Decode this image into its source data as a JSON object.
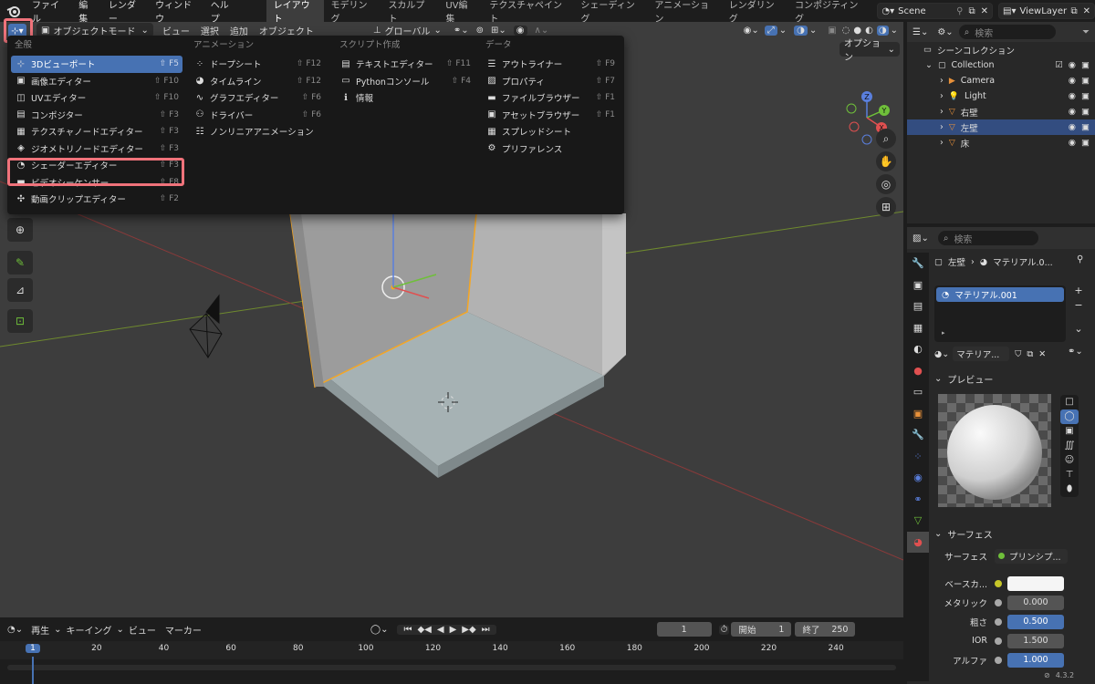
{
  "topbar": {
    "menus": [
      "ファイル",
      "編集",
      "レンダー",
      "ウィンドウ",
      "ヘルプ"
    ],
    "workspaces": [
      "レイアウト",
      "モデリング",
      "スカルプト",
      "UV編集",
      "テクスチャペイント",
      "シェーディング",
      "アニメーション",
      "レンダリング",
      "コンポジティング"
    ],
    "active_workspace": "レイアウト",
    "scene": "Scene",
    "view_layer": "ViewLayer"
  },
  "viewport_header": {
    "mode": "オブジェクトモード",
    "menus": [
      "ビュー",
      "選択",
      "追加",
      "オブジェクト"
    ],
    "transform": "グローバル",
    "options": "オプション"
  },
  "editor_menu": {
    "columns": [
      {
        "title": "全般",
        "items": [
          {
            "label": "3Dビューポート",
            "shortcut": "⇧ F5",
            "icon": "3d-viewport-icon",
            "glyph": "⊹",
            "selected": true
          },
          {
            "label": "画像エディター",
            "shortcut": "⇧ F10",
            "icon": "image-editor-icon",
            "glyph": "▣"
          },
          {
            "label": "UVエディター",
            "shortcut": "⇧ F10",
            "icon": "uv-editor-icon",
            "glyph": "◫"
          },
          {
            "label": "コンポジター",
            "shortcut": "⇧ F3",
            "icon": "compositor-icon",
            "glyph": "▤"
          },
          {
            "label": "テクスチャノードエディター",
            "shortcut": "⇧ F3",
            "icon": "texture-node-icon",
            "glyph": "▦"
          },
          {
            "label": "ジオメトリノードエディター",
            "shortcut": "⇧ F3",
            "icon": "geometry-node-icon",
            "glyph": "◈"
          },
          {
            "label": "シェーダーエディター",
            "shortcut": "⇧ F3",
            "icon": "shader-editor-icon",
            "glyph": "◔"
          },
          {
            "label": "ビデオシーケンサー",
            "shortcut": "⇧ F8",
            "icon": "video-sequencer-icon",
            "glyph": "▬"
          },
          {
            "label": "動画クリップエディター",
            "shortcut": "⇧ F2",
            "icon": "movie-clip-icon",
            "glyph": "✣"
          }
        ]
      },
      {
        "title": "アニメーション",
        "items": [
          {
            "label": "ドープシート",
            "shortcut": "⇧ F12",
            "icon": "dopesheet-icon",
            "glyph": "⁘"
          },
          {
            "label": "タイムライン",
            "shortcut": "⇧ F12",
            "icon": "timeline-icon",
            "glyph": "◕"
          },
          {
            "label": "グラフエディター",
            "shortcut": "⇧ F6",
            "icon": "graph-editor-icon",
            "glyph": "∿"
          },
          {
            "label": "ドライバー",
            "shortcut": "⇧ F6",
            "icon": "drivers-icon",
            "glyph": "⚇"
          },
          {
            "label": "ノンリニアアニメーション",
            "shortcut": "",
            "icon": "nla-icon",
            "glyph": "☷"
          }
        ]
      },
      {
        "title": "スクリプト作成",
        "items": [
          {
            "label": "テキストエディター",
            "shortcut": "⇧ F11",
            "icon": "text-editor-icon",
            "glyph": "▤"
          },
          {
            "label": "Pythonコンソール",
            "shortcut": "⇧ F4",
            "icon": "python-console-icon",
            "glyph": "▭"
          },
          {
            "label": "情報",
            "shortcut": "",
            "icon": "info-icon",
            "glyph": "ℹ"
          }
        ]
      },
      {
        "title": "データ",
        "items": [
          {
            "label": "アウトライナー",
            "shortcut": "⇧ F9",
            "icon": "outliner-icon",
            "glyph": "☰"
          },
          {
            "label": "プロパティ",
            "shortcut": "⇧ F7",
            "icon": "properties-icon",
            "glyph": "▨"
          },
          {
            "label": "ファイルブラウザー",
            "shortcut": "⇧ F1",
            "icon": "file-browser-icon",
            "glyph": "▬"
          },
          {
            "label": "アセットブラウザー",
            "shortcut": "⇧ F1",
            "icon": "asset-browser-icon",
            "glyph": "▣"
          },
          {
            "label": "スプレッドシート",
            "shortcut": "",
            "icon": "spreadsheet-icon",
            "glyph": "▦"
          },
          {
            "label": "プリファレンス",
            "shortcut": "",
            "icon": "preferences-icon",
            "glyph": "⚙"
          }
        ]
      }
    ]
  },
  "outliner": {
    "search_placeholder": "検索",
    "scene_collection": "シーンコレクション",
    "items": [
      {
        "label": "Collection",
        "indent": 1,
        "icon": "collection-icon",
        "glyph": "▢",
        "color": "#ddd",
        "selected": false
      },
      {
        "label": "Camera",
        "indent": 2,
        "icon": "camera-icon",
        "glyph": "▶",
        "color": "#e8913a",
        "selected": false
      },
      {
        "label": "Light",
        "indent": 2,
        "icon": "light-icon",
        "glyph": "💡",
        "color": "#e8913a",
        "selected": false
      },
      {
        "label": "右壁",
        "indent": 2,
        "icon": "mesh-icon",
        "glyph": "▽",
        "color": "#e8913a",
        "selected": false
      },
      {
        "label": "左壁",
        "indent": 2,
        "icon": "mesh-icon",
        "glyph": "▽",
        "color": "#e8913a",
        "selected": true
      },
      {
        "label": "床",
        "indent": 2,
        "icon": "mesh-icon",
        "glyph": "▽",
        "color": "#e8913a",
        "selected": false
      }
    ]
  },
  "properties": {
    "search_placeholder": "検索",
    "breadcrumb_object": "左壁",
    "breadcrumb_material": "マテリアル.0...",
    "material_slot": "マテリアル.001",
    "material_name": "マテリア...",
    "preview_label": "プレビュー",
    "surface_label": "サーフェス",
    "surface_field_label": "サーフェス",
    "surface_shader": "プリンシプ...",
    "fields": [
      {
        "label": "ベースカ...",
        "value": "",
        "type": "color"
      },
      {
        "label": "メタリック",
        "value": "0.000",
        "type": "num"
      },
      {
        "label": "粗さ",
        "value": "0.500",
        "type": "blue"
      },
      {
        "label": "IOR",
        "value": "1.500",
        "type": "num"
      },
      {
        "label": "アルファ",
        "value": "1.000",
        "type": "blue"
      }
    ]
  },
  "timeline": {
    "playback": "再生",
    "keying": "キーイング",
    "view": "ビュー",
    "marker": "マーカー",
    "current_frame": "1",
    "start_label": "開始",
    "start": "1",
    "end_label": "終了",
    "end": "250",
    "ruler": [
      "1",
      "20",
      "40",
      "60",
      "80",
      "100",
      "120",
      "140",
      "160",
      "180",
      "200",
      "220",
      "240"
    ]
  },
  "status": {
    "version": "4.3.2"
  },
  "colors": {
    "accent": "#4772b3",
    "highlight": "#f0737b",
    "selection_orange": "#e8913a"
  }
}
